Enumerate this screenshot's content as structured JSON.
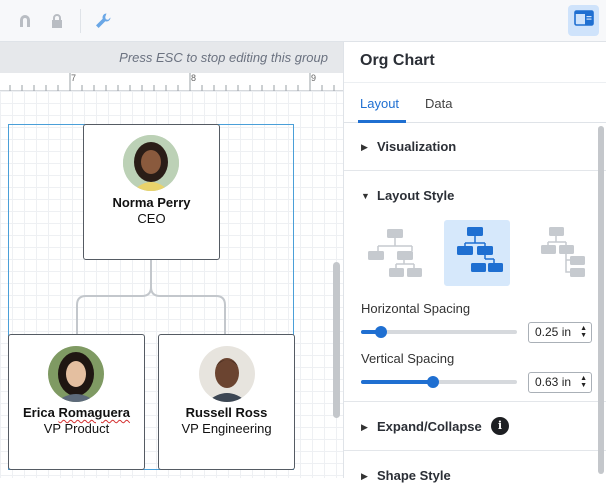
{
  "toolbar": {
    "icons": [
      "magnet-icon",
      "lock-icon",
      "wrench-icon",
      "panel-toggle-icon"
    ]
  },
  "banner": {
    "text": "Press ESC to stop editing this group"
  },
  "ruler": {
    "labels": [
      "7",
      "8",
      "9"
    ]
  },
  "org_chart": {
    "root": {
      "name": "Norma Perry",
      "role": "CEO"
    },
    "children": [
      {
        "name_plain": "Erica ",
        "name_flagged": "Romaguera",
        "role": "VP Product"
      },
      {
        "name": "Russell Ross",
        "role": "VP Engineering"
      }
    ]
  },
  "panel": {
    "title": "Org Chart",
    "tabs": [
      {
        "label": "Layout",
        "active": true
      },
      {
        "label": "Data",
        "active": false
      }
    ],
    "sections": {
      "visualization": "Visualization",
      "layout_style": "Layout Style",
      "expand_collapse": "Expand/Collapse",
      "shape_style": "Shape Style"
    },
    "layout_options": [
      "layout-tree-gray",
      "layout-tree-selected",
      "layout-tree-side"
    ],
    "selected_layout_index": 1,
    "horizontal_spacing": {
      "label": "Horizontal Spacing",
      "value": "0.25 in",
      "level": 0.13
    },
    "vertical_spacing": {
      "label": "Vertical Spacing",
      "value": "0.63 in",
      "level": 0.46
    },
    "info_glyph": "i",
    "accent_color": "#1f6fd1"
  }
}
